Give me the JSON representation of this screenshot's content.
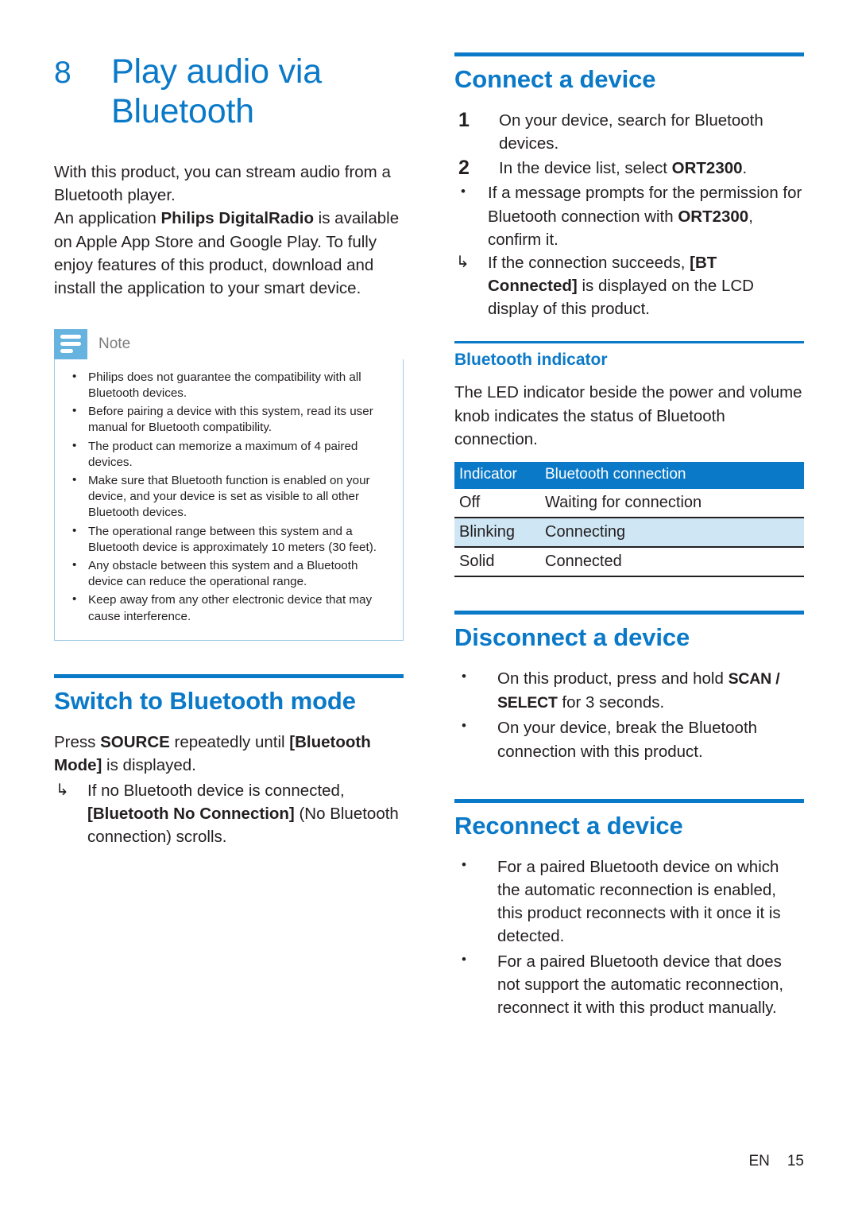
{
  "chapter": {
    "number": "8",
    "title_line1": "Play audio via",
    "title_line2": "Bluetooth"
  },
  "intro": {
    "para1": "With this product, you can stream audio from a Bluetooth player.",
    "para2_pre": "An application ",
    "para2_bold": "Philips DigitalRadio",
    "para2_post": " is available on Apple App Store and Google Play. To fully enjoy features of this product, download and install the application to your smart device."
  },
  "note": {
    "label": "Note",
    "icon": "note-lines-icon",
    "items": [
      "Philips does not guarantee the compatibility with all Bluetooth devices.",
      "Before pairing a device with this system, read its user manual for Bluetooth compatibility.",
      "The product can memorize a maximum of 4 paired devices.",
      "Make sure that Bluetooth function is enabled on your device, and your device is set as visible to all other Bluetooth devices.",
      "The operational range between this system and a Bluetooth device is approximately 10 meters (30 feet).",
      "Any obstacle between this system and a Bluetooth device can reduce the operational range.",
      "Keep away from any other electronic device that may cause interference."
    ]
  },
  "switch_mode": {
    "heading": "Switch to Bluetooth mode",
    "para_pre": "Press ",
    "para_key": "SOURCE",
    "para_mid": " repeatedly until ",
    "para_bold": "[Bluetooth Mode]",
    "para_post": " is displayed.",
    "arrow_marker": "↳",
    "arrow_pre": "If no Bluetooth device is connected, ",
    "arrow_bold": "[Bluetooth No Connection]",
    "arrow_post": " (No Bluetooth connection) scrolls."
  },
  "connect": {
    "heading": "Connect a device",
    "steps": [
      {
        "num": "1",
        "text": "On your device, search for Bluetooth devices."
      },
      {
        "num": "2",
        "pre": "In the device list, select ",
        "bold": "ORT2300",
        "post": "."
      }
    ],
    "sub_bullets": [
      {
        "marker": "•",
        "pre": "If a message prompts for the permission for Bluetooth connection with ",
        "bold": "ORT2300",
        "post": ", confirm it."
      },
      {
        "marker": "↳",
        "pre": "If the connection succeeds, ",
        "bold": "[BT Connected]",
        "post": " is displayed on the LCD display of this product."
      }
    ]
  },
  "indicator": {
    "heading": "Bluetooth indicator",
    "para": "The LED indicator beside the power and volume knob indicates the status of Bluetooth connection.",
    "table": {
      "columns": [
        "Indicator",
        "Bluetooth connection"
      ],
      "rows": [
        {
          "indicator": "Off",
          "connection": "Waiting for connection",
          "highlight": false
        },
        {
          "indicator": "Blinking",
          "connection": "Connecting",
          "highlight": true
        },
        {
          "indicator": "Solid",
          "connection": "Connected",
          "highlight": false
        }
      ]
    }
  },
  "disconnect": {
    "heading": "Disconnect a device",
    "bullets": [
      {
        "marker": "•",
        "pre": "On this product, press and hold ",
        "key": "SCAN / SELECT",
        "post": " for 3 seconds."
      },
      {
        "marker": "•",
        "pre": "On your device, break the Bluetooth connection with this product.",
        "key": "",
        "post": ""
      }
    ]
  },
  "reconnect": {
    "heading": "Reconnect a device",
    "bullets": [
      "For a paired Bluetooth device on which the automatic reconnection is enabled, this product reconnects with it once it is detected.",
      "For a paired Bluetooth device that does not support the automatic reconnection, reconnect it with this product manually."
    ]
  },
  "footer": {
    "language": "EN",
    "page": "15"
  },
  "colors": {
    "accent_blue": "#0a79c8",
    "note_icon_blue": "#66b3e0",
    "note_border": "#9fcbe6",
    "table_alt_row": "#cfe7f5",
    "text": "#231f20"
  }
}
